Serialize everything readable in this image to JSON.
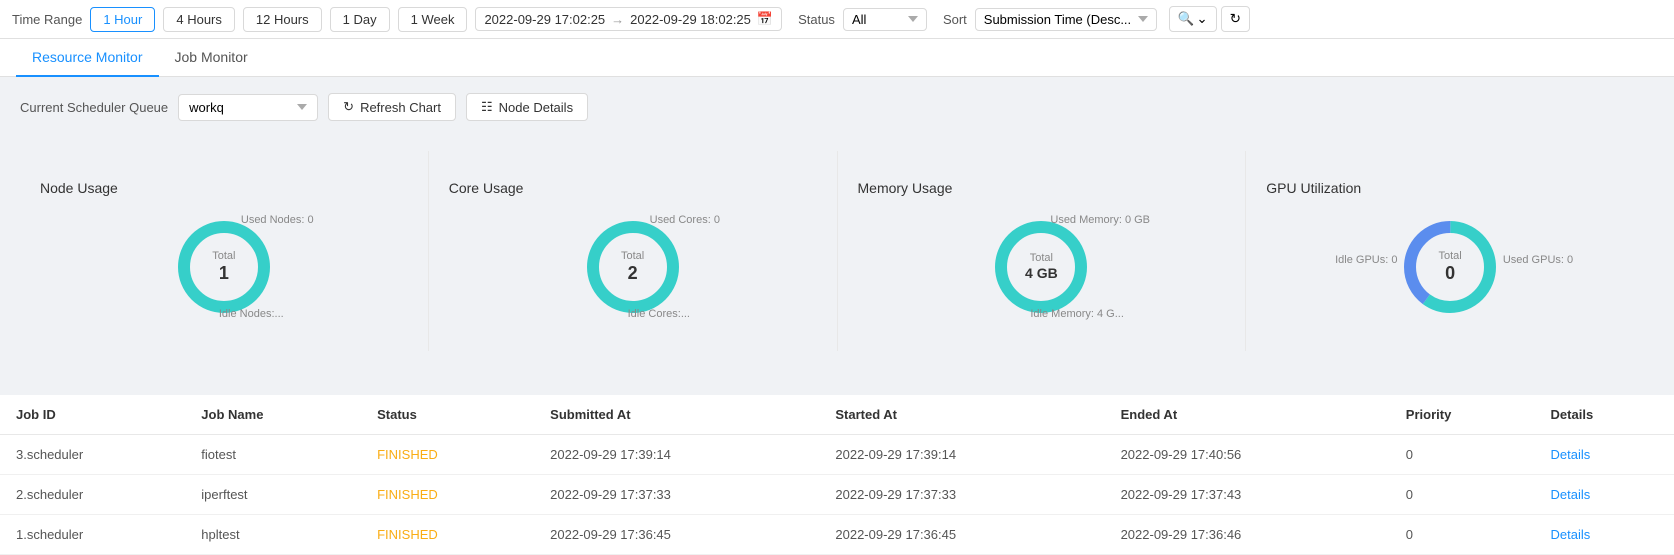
{
  "topbar": {
    "time_range_label": "Time Range",
    "time_buttons": [
      "1 Hour",
      "4 Hours",
      "12 Hours",
      "1 Day",
      "1 Week"
    ],
    "active_time": "1 Hour",
    "datetime_start": "2022-09-29 17:02:25",
    "datetime_end": "2022-09-29 18:02:25",
    "status_label": "Status",
    "status_value": "All",
    "sort_label": "Sort",
    "sort_value": "Submission Time (Desc..."
  },
  "tabs": [
    {
      "id": "resource-monitor",
      "label": "Resource Monitor",
      "active": true
    },
    {
      "id": "job-monitor",
      "label": "Job Monitor",
      "active": false
    }
  ],
  "resource_panel": {
    "queue_label": "Current Scheduler Queue",
    "queue_value": "workq",
    "refresh_btn": "Refresh Chart",
    "node_details_btn": "Node Details"
  },
  "charts": [
    {
      "title": "Node Usage",
      "total_label": "Total",
      "total_value": "1",
      "used_label": "Used Nodes: 0",
      "idle_label": "Idle Nodes:...",
      "used_pct": 0,
      "colors": {
        "used": "#52c41a",
        "idle": "#36cfc9",
        "bg": "#f5f5f5"
      }
    },
    {
      "title": "Core Usage",
      "total_label": "Total",
      "total_value": "2",
      "used_label": "Used Cores: 0",
      "idle_label": "Idle Cores:...",
      "used_pct": 0,
      "colors": {
        "used": "#52c41a",
        "idle": "#36cfc9",
        "bg": "#f5f5f5"
      }
    },
    {
      "title": "Memory Usage",
      "total_label": "Total",
      "total_value": "4 GB",
      "used_label": "Used Memory: 0 GB",
      "idle_label": "Idle Memory: 4 G...",
      "used_pct": 0,
      "colors": {
        "used": "#52c41a",
        "idle": "#36cfc9",
        "bg": "#f5f5f5"
      }
    },
    {
      "title": "GPU Utilization",
      "total_label": "Total",
      "total_value": "0",
      "used_label": "Used GPUs: 0",
      "idle_label": "Idle GPUs: 0",
      "used_pct": 40,
      "colors": {
        "used": "#36cfc9",
        "idle": "#5b8dee",
        "bg": "#f5f5f5"
      }
    }
  ],
  "job_table": {
    "columns": [
      "Job ID",
      "Job Name",
      "Status",
      "Submitted At",
      "Started At",
      "Ended At",
      "Priority",
      "Details"
    ],
    "rows": [
      {
        "job_id": "3.scheduler",
        "job_name": "fiotest",
        "status": "FINISHED",
        "submitted_at": "2022-09-29 17:39:14",
        "started_at": "2022-09-29 17:39:14",
        "ended_at": "2022-09-29 17:40:56",
        "priority": "0",
        "details": "Details"
      },
      {
        "job_id": "2.scheduler",
        "job_name": "iperftest",
        "status": "FINISHED",
        "submitted_at": "2022-09-29 17:37:33",
        "started_at": "2022-09-29 17:37:33",
        "ended_at": "2022-09-29 17:37:43",
        "priority": "0",
        "details": "Details"
      },
      {
        "job_id": "1.scheduler",
        "job_name": "hpltest",
        "status": "FINISHED",
        "submitted_at": "2022-09-29 17:36:45",
        "started_at": "2022-09-29 17:36:45",
        "ended_at": "2022-09-29 17:36:46",
        "priority": "0",
        "details": "Details"
      }
    ]
  }
}
